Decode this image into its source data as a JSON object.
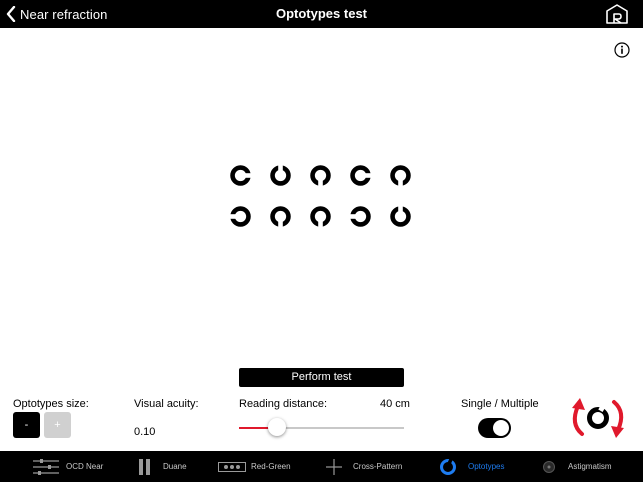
{
  "header": {
    "back_label": "Near refraction",
    "title": "Optotypes test",
    "back_icon": "chevron-left-icon",
    "home_icon": "home-icon"
  },
  "info_icon": "info-icon",
  "optotypes": {
    "gap_directions": [
      "right",
      "up",
      "down",
      "right",
      "down",
      "left",
      "down",
      "down",
      "left",
      "up"
    ]
  },
  "controls": {
    "perform_test_label": "Perform test",
    "size_label": "Optotypes size:",
    "size_minus_label": "-",
    "size_plus_label": "+",
    "acuity_label": "Visual acuity:",
    "acuity_value": "0.10",
    "distance_label": "Reading distance:",
    "distance_value": "40 cm",
    "distance_slider_fraction": 0.23,
    "mode_label": "Single / Multiple",
    "mode_toggle_on": true,
    "rotate_icon": "rotate-optotype-icon"
  },
  "colors": {
    "accent": "#1e7cf0",
    "slider_fill": "#e0192c",
    "rotate_arrows": "#e0192c"
  },
  "tabs": [
    {
      "label": "OCD Near",
      "icon": "sliders-icon",
      "active": false
    },
    {
      "label": "Duane",
      "icon": "duane-bars-icon",
      "active": false
    },
    {
      "label": "Red-Green",
      "icon": "red-green-icon",
      "active": false
    },
    {
      "label": "Cross-Pattern",
      "icon": "cross-icon",
      "active": false
    },
    {
      "label": "Optotypes",
      "icon": "landolt-ring-icon",
      "active": true
    },
    {
      "label": "Astigmatism",
      "icon": "astigmatism-icon",
      "active": false
    }
  ]
}
